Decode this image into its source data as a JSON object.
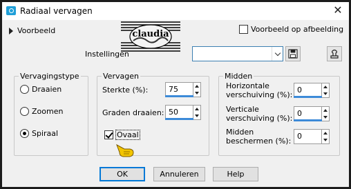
{
  "window": {
    "title": "Radiaal vervagen",
    "close_glyph": "✕"
  },
  "preview": {
    "toggle_label": "Voorbeeld",
    "preview_on_image_label": "Voorbeeld op afbeelding",
    "preview_on_image_checked": false
  },
  "watermark": {
    "text": "claudia"
  },
  "settings": {
    "label": "Instellingen",
    "preset_value": ""
  },
  "blur_type": {
    "legend": "Vervagingstype",
    "options": [
      {
        "label": "Draaien",
        "selected": false
      },
      {
        "label": "Zoomen",
        "selected": false
      },
      {
        "label": "Spiraal",
        "selected": true
      }
    ]
  },
  "blur": {
    "legend": "Vervagen",
    "strength_label": "Sterkte (%):",
    "strength_value": "75",
    "twist_label": "Graden draaien:",
    "twist_value": "50",
    "oval_label": "Ovaal",
    "oval_checked": true
  },
  "center": {
    "legend": "Midden",
    "h_offset_label_1": "Horizontale",
    "h_offset_label_2": "verschuiving (%):",
    "h_offset_value": "0",
    "v_offset_label_1": "Verticale",
    "v_offset_label_2": "verschuiving (%):",
    "v_offset_value": "0",
    "protect_label_1": "Midden",
    "protect_label_2": "beschermen (%):",
    "protect_value": "0"
  },
  "buttons": {
    "ok": "OK",
    "cancel": "Annuleren",
    "help": "Help"
  },
  "colors": {
    "accent": "#0078d7",
    "spin_bar": "#3c8ad8",
    "hand": "#f2c500"
  }
}
